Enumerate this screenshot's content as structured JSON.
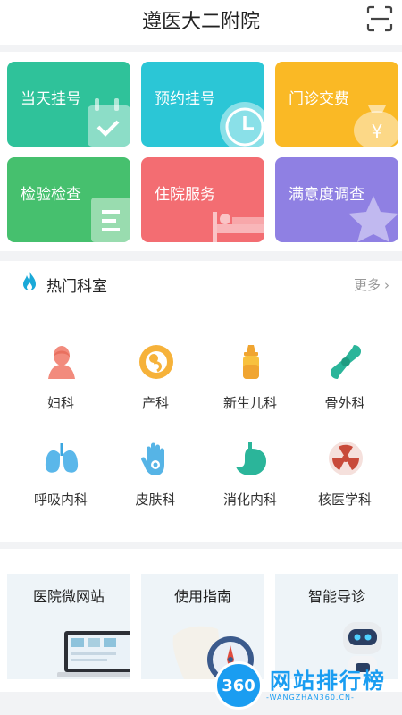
{
  "header": {
    "title": "遵医大二附院"
  },
  "cards": [
    {
      "label": "当天挂号",
      "color": "#2fc29a"
    },
    {
      "label": "预约挂号",
      "color": "#2bc6d6"
    },
    {
      "label": "门诊交费",
      "color": "#fab925"
    },
    {
      "label": "检验检查",
      "color": "#46c06e"
    },
    {
      "label": "住院服务",
      "color": "#f36d72"
    },
    {
      "label": "满意度调查",
      "color": "#8f80e3"
    }
  ],
  "departments": {
    "title": "热门科室",
    "more": "更多",
    "items": [
      {
        "label": "妇科",
        "icon": "woman-icon"
      },
      {
        "label": "产科",
        "icon": "fetus-icon"
      },
      {
        "label": "新生儿科",
        "icon": "baby-bottle-icon"
      },
      {
        "label": "骨外科",
        "icon": "bone-joint-icon"
      },
      {
        "label": "呼吸内科",
        "icon": "lungs-icon"
      },
      {
        "label": "皮肤科",
        "icon": "hand-skin-icon"
      },
      {
        "label": "消化内科",
        "icon": "stomach-icon"
      },
      {
        "label": "核医学科",
        "icon": "radiation-icon"
      }
    ]
  },
  "services": [
    {
      "label": "医院微网站"
    },
    {
      "label": "使用指南"
    },
    {
      "label": "智能导诊"
    }
  ],
  "watermark": {
    "badge": "360",
    "text": "网站排行榜",
    "sub": "-WANGZHAN360.CN-"
  }
}
